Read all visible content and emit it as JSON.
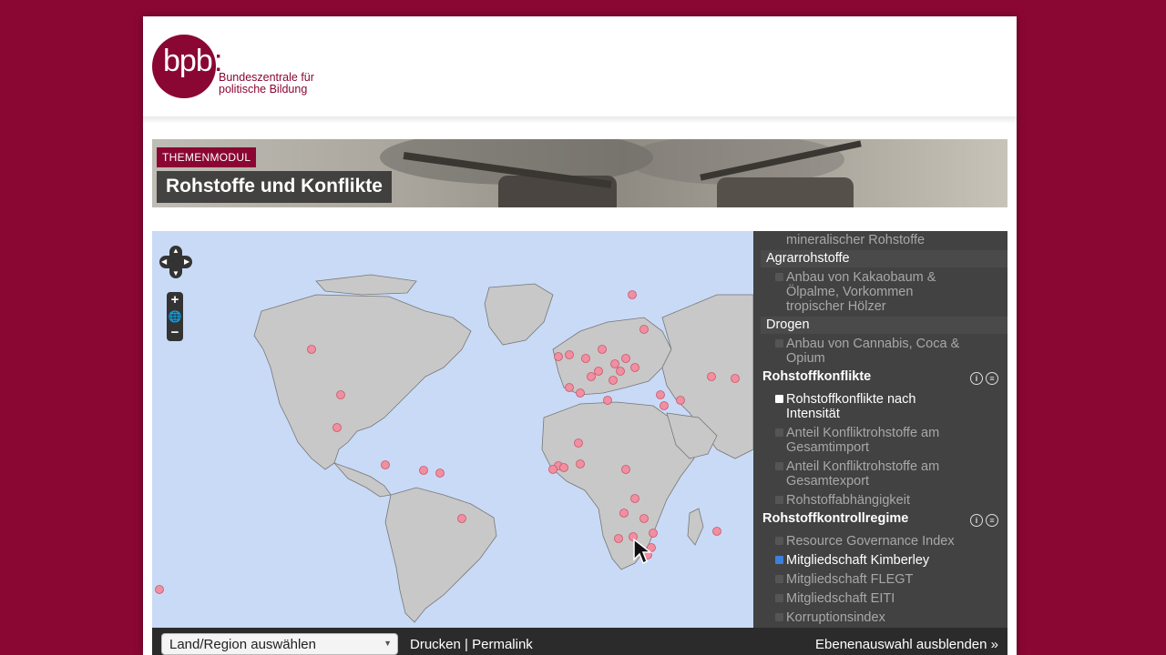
{
  "header": {
    "logo_text": "bpb",
    "org_line1": "Bundeszentrale für",
    "org_line2": "politische Bildung"
  },
  "banner": {
    "tag": "THEMENMODUL",
    "title": "Rohstoffe und Konflikte"
  },
  "map": {
    "zoom_in": "+",
    "zoom_out": "−",
    "marker_color": "#f08fa0",
    "land_color": "#c8c8c8",
    "sea_color": "#c9daf6"
  },
  "layers": {
    "items_top": [
      {
        "label": "mineralischer Rohstoffe",
        "state": "inactive"
      }
    ],
    "groups": [
      {
        "title": "Agrarrohstoffe",
        "items": [
          "Anbau von Kakaobaum &",
          "Ölpalme, Vorkommen",
          "tropischer Hölzer"
        ]
      },
      {
        "title": "Drogen",
        "items": [
          "Anbau von Cannabis, Coca &",
          "Opium"
        ]
      }
    ],
    "sections": [
      {
        "title": "Rohstoffkonflikte",
        "items": [
          {
            "label1": "Rohstoffkonflikte nach",
            "label2": "Intensität",
            "state": "active"
          },
          {
            "label1": "Anteil Konfliktrohstoffe am",
            "label2": "Gesamtimport",
            "state": "inactive"
          },
          {
            "label1": "Anteil Konfliktrohstoffe am",
            "label2": "Gesamtexport",
            "state": "inactive"
          },
          {
            "label1": "Rohstoffabhängigkeit",
            "label2": "",
            "state": "inactive"
          }
        ]
      },
      {
        "title": "Rohstoffkontrollregime",
        "items": [
          {
            "label1": "Resource Governance Index",
            "state": "inactive"
          },
          {
            "label1": "Mitgliedschaft Kimberley",
            "state": "checked"
          },
          {
            "label1": "Mitgliedschaft FLEGT",
            "state": "inactive"
          },
          {
            "label1": "Mitgliedschaft EITI",
            "state": "inactive"
          },
          {
            "label1": "Korruptionsindex",
            "state": "inactive"
          }
        ]
      }
    ],
    "info_icon": "i",
    "list_icon": "≡"
  },
  "bottom_bar": {
    "region_select": "Land/Region auswählen",
    "print": "Drucken",
    "separator": "|",
    "permalink": "Permalink",
    "hide_layers": "Ebenenauswahl ausblenden »"
  }
}
